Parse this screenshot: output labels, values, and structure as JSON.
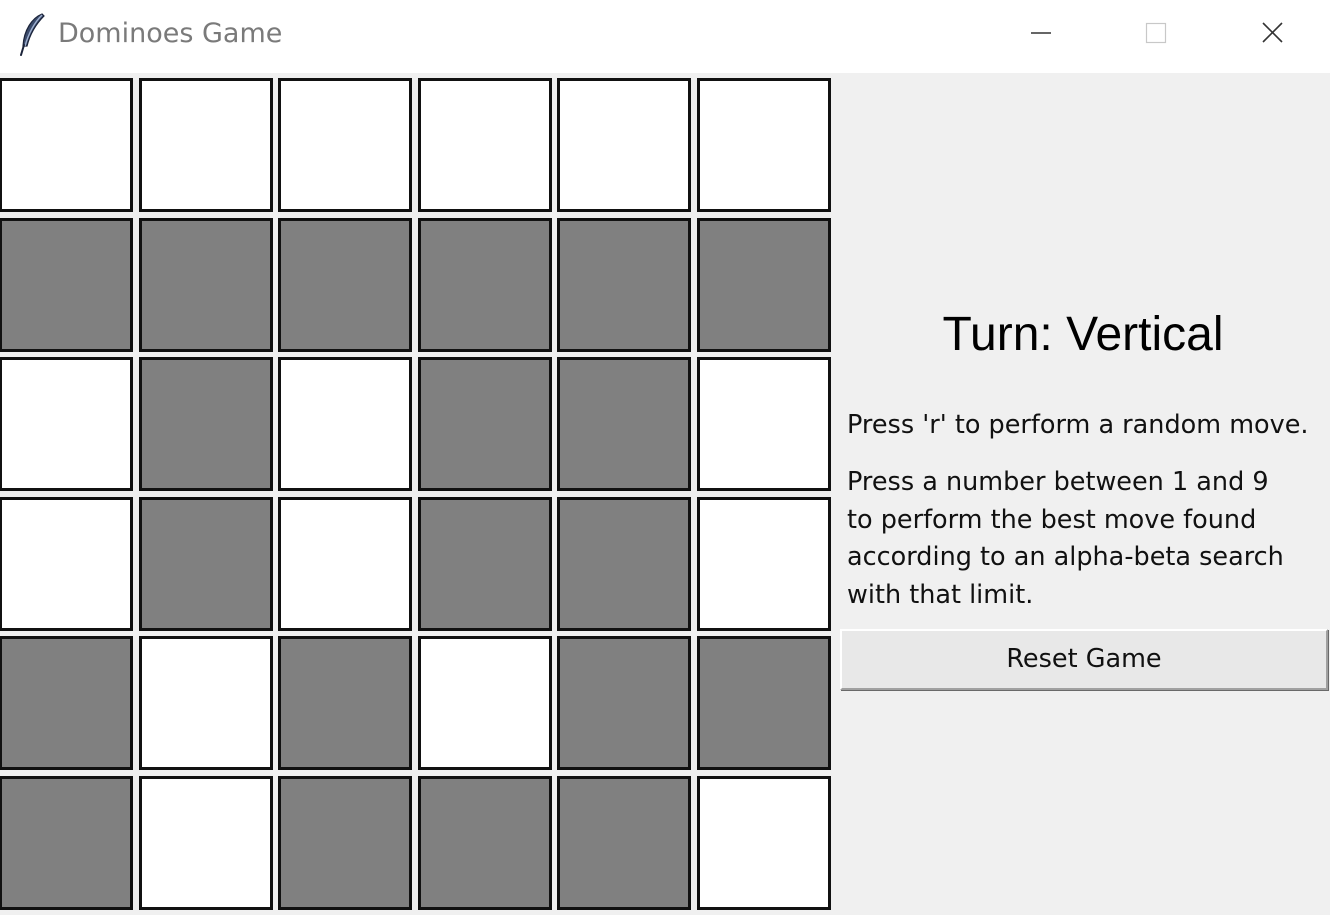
{
  "window": {
    "title": "Dominoes Game",
    "icon": "feather-icon",
    "controls": [
      "minimize-icon",
      "maximize-icon",
      "close-icon"
    ]
  },
  "board": {
    "rows": 6,
    "cols": 6,
    "cells": [
      [
        "empty",
        "empty",
        "empty",
        "empty",
        "empty",
        "empty"
      ],
      [
        "filled",
        "filled",
        "filled",
        "filled",
        "filled",
        "filled"
      ],
      [
        "empty",
        "filled",
        "empty",
        "filled",
        "filled",
        "empty"
      ],
      [
        "empty",
        "filled",
        "empty",
        "filled",
        "filled",
        "empty"
      ],
      [
        "filled",
        "empty",
        "filled",
        "empty",
        "filled",
        "filled"
      ],
      [
        "filled",
        "empty",
        "filled",
        "filled",
        "filled",
        "empty"
      ]
    ],
    "colors": {
      "empty": "#ffffff",
      "filled": "#808080",
      "border": "#111111"
    }
  },
  "panel": {
    "turn_label": "Turn: Vertical",
    "random_hint": "Press 'r' to perform a random move.",
    "search_hint_lines": [
      "Press a number between 1 and 9",
      "to perform the best move found",
      "according to an alpha-beta search",
      "with that limit."
    ],
    "reset_label": "Reset Game"
  }
}
